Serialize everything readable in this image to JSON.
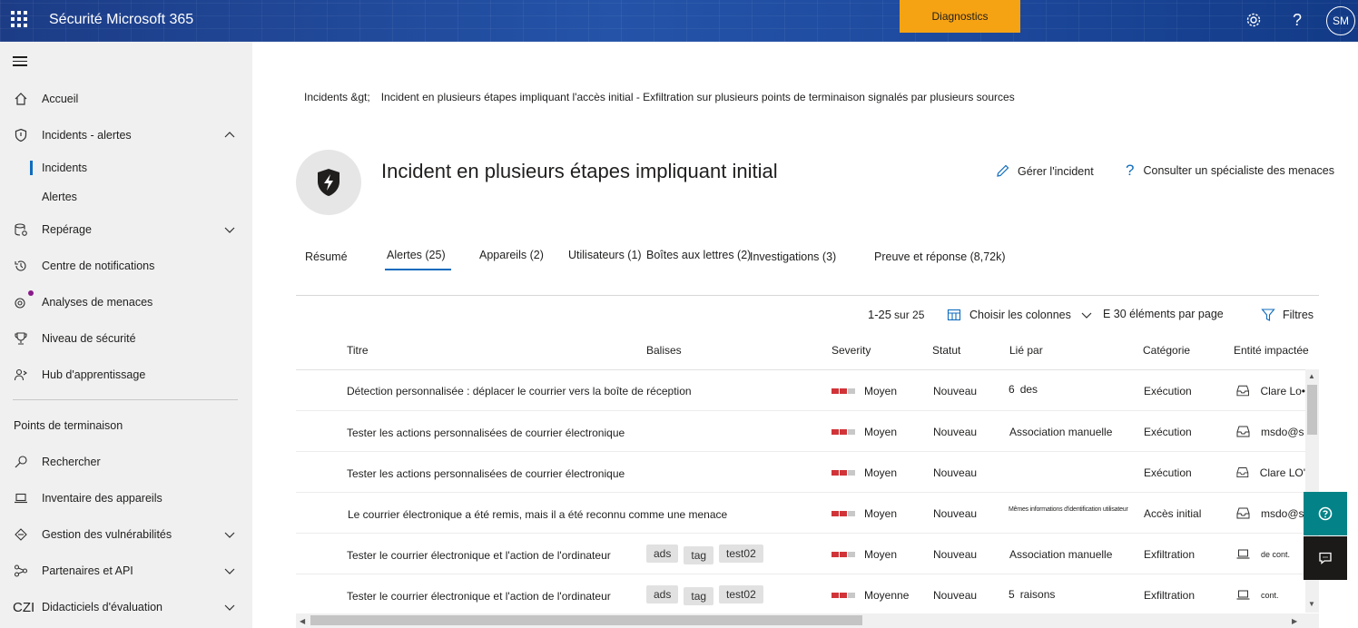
{
  "header": {
    "app_title": "Sécurité Microsoft 365",
    "diagnostics_label": "Diagnostics",
    "settings_icon": "gear-icon",
    "help_icon": "question-icon",
    "avatar_initials": "SM",
    "brand_color": "#1b3f8f"
  },
  "sidebar": {
    "items": [
      {
        "label": "Accueil",
        "icon": "home-icon"
      },
      {
        "label": "Incidents - alertes",
        "icon": "shield-icon"
      },
      {
        "label": "Incidents"
      },
      {
        "label": "Alertes"
      },
      {
        "label": "Repérage",
        "icon": "database-icon"
      },
      {
        "label": "Centre de notifications",
        "icon": "history-icon"
      },
      {
        "label": "Analyses de menaces",
        "icon": "threat-icon"
      },
      {
        "label": "Niveau de sécurité",
        "icon": "trophy-icon"
      },
      {
        "label": "Hub d'apprentissage",
        "icon": "learning-icon"
      }
    ],
    "section_title": "Points de terminaison",
    "section_items": [
      {
        "label": "Rechercher",
        "icon": "search-icon"
      },
      {
        "label": "Inventaire des appareils",
        "icon": "laptop-icon"
      },
      {
        "label": "Gestion des vulnérabilités",
        "icon": "vulnerability-icon"
      },
      {
        "label": "Partenaires et API",
        "icon": "partners-icon"
      },
      {
        "label": "Didacticiels d'évaluation",
        "icon_text": "CZI"
      }
    ]
  },
  "breadcrumb": {
    "root": "Incidents &gt;",
    "current": "Incident en plusieurs étapes impliquant l'accès initial - Exfiltration sur plusieurs points de terminaison signalés par plusieurs sources"
  },
  "incident": {
    "title": "Incident en plusieurs étapes impliquant initial",
    "manage_label": "Gérer l'incident",
    "consult_label": "Consulter un spécialiste des menaces"
  },
  "tabs": [
    {
      "label": "Résumé"
    },
    {
      "label": "Alertes (25)"
    },
    {
      "label": "Appareils (2)"
    },
    {
      "label": "Utilisateurs (1)"
    },
    {
      "label": "Boîtes aux lettres (2)"
    },
    {
      "label": "Investigations (3)"
    },
    {
      "label": "Preuve et réponse (8,72k)"
    }
  ],
  "toolbar": {
    "pager_range": "1-25",
    "pager_total": "sur 25",
    "choose_columns": "Choisir les colonnes",
    "per_page": "E 30 éléments par page",
    "filters": "Filtres"
  },
  "table": {
    "headers": {
      "title": "Titre",
      "tags": "Balises",
      "severity": "Severity",
      "status": "Statut",
      "linked": "Lié par",
      "category": "Catégorie",
      "entity": "Entité impactée"
    },
    "rows": [
      {
        "title": "Détection personnalisée : déplacer le courrier vers la boîte de réception",
        "tags": [],
        "severity": "Moyen",
        "status": "Nouveau",
        "linked_num": "6",
        "linked": "des",
        "category": "Exécution",
        "entity": "Clare Lo•",
        "entity_icon": "mailbox-icon"
      },
      {
        "title": "Tester les actions personnalisées de courrier électronique",
        "tags": [],
        "severity": "Moyen",
        "status": "Nouveau",
        "linked_num": "",
        "linked": "Association manuelle",
        "category": "Exécution",
        "entity": "msdo@s",
        "entity_icon": "mailbox-icon"
      },
      {
        "title": "Tester les actions personnalisées de courrier électronique",
        "tags": [],
        "severity": "Moyen",
        "status": "Nouveau",
        "linked_num": "",
        "linked": "",
        "category": "Exécution",
        "entity": "Clare LO'",
        "entity_icon": "mailbox-icon"
      },
      {
        "title": "Le courrier électronique a été remis, mais il a été reconnu comme une menace",
        "tags": [],
        "severity": "Moyen",
        "status": "Nouveau",
        "linked_num": "",
        "linked": "Mêmes informations d'identification utilisateur",
        "category": "Accès initial",
        "entity": "msdo@s",
        "entity_icon": "mailbox-icon"
      },
      {
        "title": "Tester le courrier électronique et l'action de l'ordinateur",
        "tags": [
          "ads",
          "tag",
          "test02"
        ],
        "severity": "Moyen",
        "status": "Nouveau",
        "linked_num": "",
        "linked": "Association manuelle",
        "category": "Exfiltration",
        "entity": "de cont.",
        "entity_icon": "laptop-icon"
      },
      {
        "title": "Tester le courrier électronique et l'action de l'ordinateur",
        "tags": [
          "ads",
          "tag",
          "test02"
        ],
        "severity": "Moyenne",
        "status": "Nouveau",
        "linked_num": "5",
        "linked": "raisons",
        "category": "Exfiltration",
        "entity": "cont.",
        "entity_icon": "laptop-icon"
      }
    ]
  },
  "colors": {
    "accent": "#0f6cbd",
    "severity_on": "#d13438",
    "severity_off": "#c8c8c8",
    "diagnostics_bg": "#f6a313",
    "floating_help_bg": "#038387",
    "floating_feedback_bg": "#1b1a19"
  },
  "floating": {
    "help_icon": "help-circle-icon",
    "feedback_icon": "chat-icon"
  }
}
